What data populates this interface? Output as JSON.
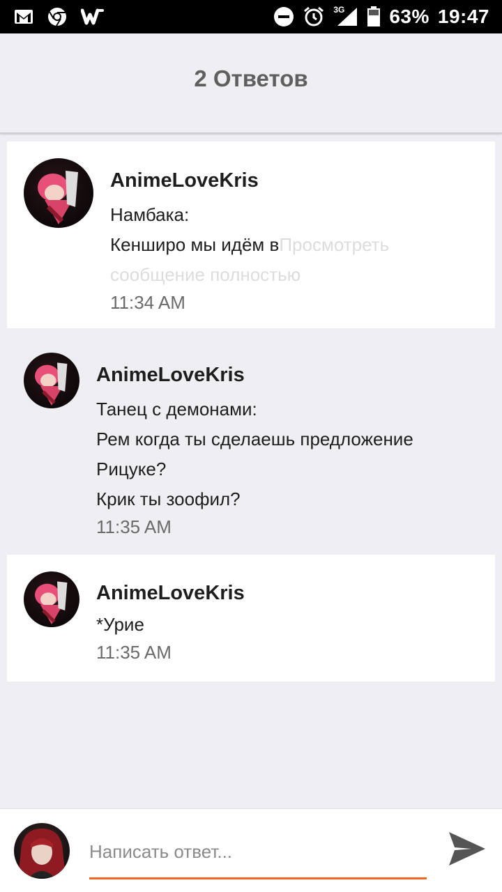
{
  "status_bar": {
    "icons": [
      "gmail-icon",
      "chrome-icon",
      "wattpad-icon"
    ],
    "right_icons": [
      "do-not-disturb-icon",
      "alarm-icon",
      "signal-icon",
      "battery-icon"
    ],
    "network": "3G",
    "battery": "63%",
    "time": "19:47"
  },
  "header": {
    "title": "2 Ответов"
  },
  "replies": [
    {
      "username": "AnimeLoveKris",
      "lines": [
        "Намбака:",
        "Кенширо мы идём в"
      ],
      "preview_link": "Просмотреть",
      "preview_link_cont": "сообщение полностью",
      "time": "11:34 AM"
    },
    {
      "username": "AnimeLoveKris",
      "lines": [
        "Танец с демонами:",
        "Рем когда ты сделаешь предложение",
        "Рицуке?",
        "Крик ты зоофил?"
      ],
      "time": "11:35 AM"
    },
    {
      "username": "AnimeLoveKris",
      "lines": [
        "*Урие"
      ],
      "time": "11:35 AM"
    }
  ],
  "compose": {
    "placeholder": "Написать ответ...",
    "send_icon": "send-icon",
    "accent": "#f26522"
  }
}
